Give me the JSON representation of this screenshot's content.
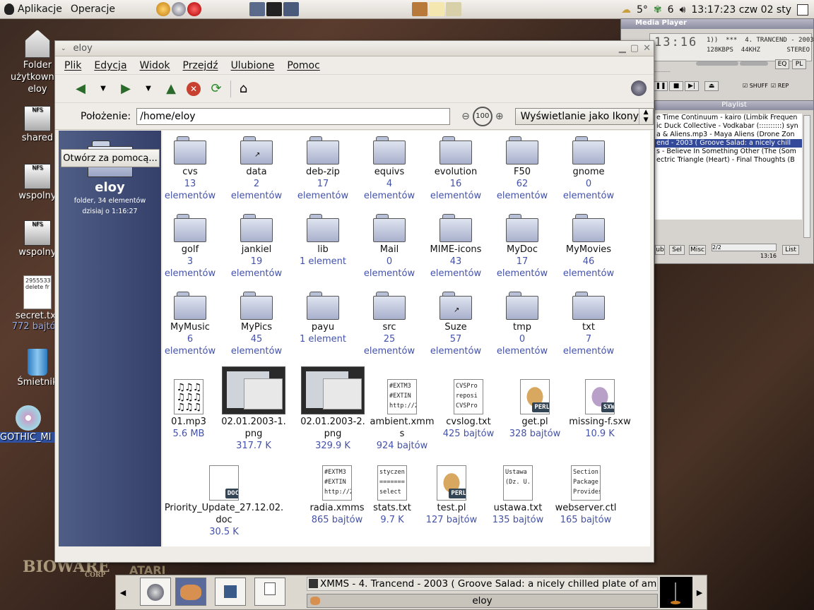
{
  "top_panel": {
    "applications": "Aplikacje",
    "actions": "Operacje",
    "weather": "5°",
    "workspace_count": "6",
    "clock": "13:17:23 czw 02 sty"
  },
  "desktop": {
    "icons": [
      {
        "label": "Folder użytkownika eloy"
      },
      {
        "label": "shared"
      },
      {
        "label": "wspolny"
      },
      {
        "label": "wspolny"
      },
      {
        "label": "secret.txt",
        "sub": "772 bajtów",
        "preview": "2955533 delete fr"
      },
      {
        "label": "Śmietnik"
      },
      {
        "label": "GOTHIC_MI"
      }
    ]
  },
  "media_player": {
    "title": "Media Player",
    "time": "13:16",
    "song": "4. TRANCEND - 2003 (",
    "kbps": "128",
    "khz": "44",
    "stereo": "STEREO",
    "eq": "EQ",
    "pl": "PL",
    "shuffle": "SHUFF",
    "repeat": "REP"
  },
  "playlist": {
    "title": "Playlist",
    "items": [
      "e Time Continuum - kairo (Limbik Frequen",
      "ic Duck Collective - Vodkabar (::::::::::) syn",
      "a & Aliens.mp3 - Maya Aliens (Drone Zon",
      "end - 2003 ( Groove Salad: a nicely chill",
      "s - Believe In Something Other (The (Som",
      "ectric Triangle (Heart) - Final Thoughts (B"
    ],
    "selected_index": 3,
    "buttons": [
      "ub",
      "Sel",
      "Misc",
      "List"
    ],
    "counter": "2/2",
    "time": "13:16"
  },
  "window": {
    "title": "eloy",
    "menu": [
      "Plik",
      "Edycja",
      "Widok",
      "Przejdź",
      "Ulubione",
      "Pomoc"
    ],
    "location_label": "Położenie:",
    "location_value": "/home/eloy",
    "zoom_level": "100",
    "view_mode": "Wyświetlanie jako Ikony",
    "side": {
      "name": "eloy",
      "info1": "folder, 34 elementów",
      "info2": "dzisiaj o 1:16:27",
      "open_with": "Otwórz za pomocą..."
    },
    "folders": [
      {
        "name": "cvs",
        "count": "13",
        "unit": "elementów"
      },
      {
        "name": "data",
        "count": "2",
        "unit": "elementów",
        "link": true
      },
      {
        "name": "deb-zip",
        "count": "17",
        "unit": "elementów"
      },
      {
        "name": "equivs",
        "count": "4",
        "unit": "elementów"
      },
      {
        "name": "evolution",
        "count": "16",
        "unit": "elementów"
      },
      {
        "name": "F50",
        "count": "62",
        "unit": "elementów"
      },
      {
        "name": "gnome",
        "count": "0",
        "unit": "elementów"
      },
      {
        "name": "golf",
        "count": "3",
        "unit": "elementów"
      },
      {
        "name": "jankiel",
        "count": "19",
        "unit": "elementów"
      },
      {
        "name": "lib",
        "count": "1 element",
        "unit": ""
      },
      {
        "name": "Mail",
        "count": "0",
        "unit": "elementów"
      },
      {
        "name": "MIME-icons",
        "count": "43",
        "unit": "elementów"
      },
      {
        "name": "MyDoc",
        "count": "17",
        "unit": "elementów"
      },
      {
        "name": "MyMovies",
        "count": "46",
        "unit": "elementów"
      },
      {
        "name": "MyMusic",
        "count": "6",
        "unit": "elementów"
      },
      {
        "name": "MyPics",
        "count": "45",
        "unit": "elementów"
      },
      {
        "name": "payu",
        "count": "1 element",
        "unit": ""
      },
      {
        "name": "src",
        "count": "25",
        "unit": "elementów"
      },
      {
        "name": "Suze",
        "count": "57",
        "unit": "elementów",
        "link": true
      },
      {
        "name": "tmp",
        "count": "0",
        "unit": "elementów"
      },
      {
        "name": "txt",
        "count": "7",
        "unit": "elementów"
      }
    ],
    "files": [
      {
        "name": "01.mp3",
        "size": "5.6 MB",
        "kind": "music"
      },
      {
        "name": "02.01.2003-1.png",
        "size": "317.7 K",
        "kind": "thumb"
      },
      {
        "name": "02.01.2003-2.png",
        "size": "329.9 K",
        "kind": "thumb"
      },
      {
        "name": "ambient.xmms",
        "size": "924 bajtów",
        "kind": "text",
        "preview": "#EXTM3 #EXTIN http://20"
      },
      {
        "name": "cvslog.txt",
        "size": "425 bajtów",
        "kind": "text",
        "preview": "CVSPro reposi CVSPro"
      },
      {
        "name": "get.pl",
        "size": "328 bajtów",
        "kind": "perl",
        "badge": "PERL"
      },
      {
        "name": "missing-f.sxw",
        "size": "10.9 K",
        "kind": "sxw",
        "badge": "SXW"
      },
      {
        "name": "Priority_Update_27.12.02.doc",
        "size": "30.5 K",
        "kind": "doc",
        "badge": "DOC"
      },
      {
        "name": "radia.xmms",
        "size": "865 bajtów",
        "kind": "text",
        "preview": "#EXTM3 #EXTIN http://20"
      },
      {
        "name": "stats.txt",
        "size": "9.7 K",
        "kind": "text",
        "preview": "styczen ======= select c"
      },
      {
        "name": "test.pl",
        "size": "127 bajtów",
        "kind": "perl",
        "badge": "PERL"
      },
      {
        "name": "ustawa.txt",
        "size": "135 bajtów",
        "kind": "text",
        "preview": "Ustawa (Dz. U."
      },
      {
        "name": "webserver.ctl",
        "size": "165 bajtów",
        "kind": "text",
        "preview": "Section: Package Provides"
      }
    ]
  },
  "bottom_panel": {
    "task_xmms": "XMMS - 4. Trancend - 2003 ( Groove Salad: a nicely chilled plate of ambien",
    "task_eloy": "eloy"
  },
  "wallpaper": {
    "logo1": "BIOWARE",
    "logo1_sub": "CORP",
    "logo2": "ATARI"
  }
}
